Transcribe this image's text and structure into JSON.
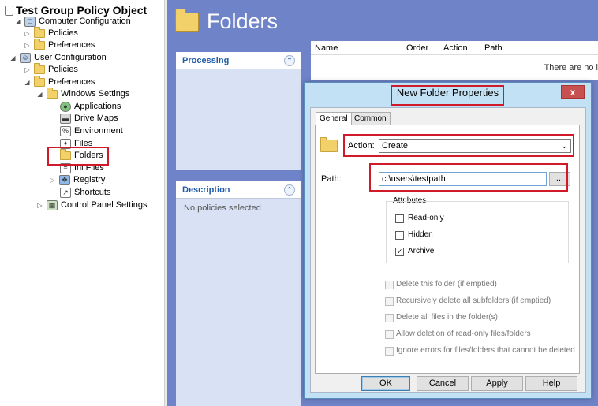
{
  "tree": {
    "root": "Test Group Policy Object",
    "items": [
      {
        "label": "Computer Configuration"
      },
      {
        "label": "Policies"
      },
      {
        "label": "Preferences"
      },
      {
        "label": "User Configuration"
      },
      {
        "label": "Policies"
      },
      {
        "label": "Preferences"
      },
      {
        "label": "Windows Settings"
      },
      {
        "label": "Applications"
      },
      {
        "label": "Drive Maps"
      },
      {
        "label": "Environment"
      },
      {
        "label": "Files"
      },
      {
        "label": "Folders"
      },
      {
        "label": "Ini Files"
      },
      {
        "label": "Registry"
      },
      {
        "label": "Shortcuts"
      },
      {
        "label": "Control Panel Settings"
      }
    ]
  },
  "header": {
    "title": "Folders"
  },
  "panels": {
    "processing": {
      "title": "Processing"
    },
    "description": {
      "title": "Description",
      "text": "No policies selected"
    }
  },
  "list": {
    "columns": [
      "Name",
      "Order",
      "Action",
      "Path"
    ],
    "empty_text": "There are no i"
  },
  "dialog": {
    "title": "New Folder Properties",
    "close": "x",
    "tabs": [
      "General",
      "Common"
    ],
    "action_label": "Action:",
    "action_value": "Create",
    "path_label": "Path:",
    "path_value": "c:\\users\\testpath",
    "browse_label": "...",
    "attributes_label": "Attributes",
    "attributes": [
      {
        "label": "Read-only",
        "checked": false
      },
      {
        "label": "Hidden",
        "checked": false
      },
      {
        "label": "Archive",
        "checked": true
      }
    ],
    "options": [
      {
        "label": "Delete this folder (if emptied)"
      },
      {
        "label": "Recursively delete all subfolders (if emptied)"
      },
      {
        "label": "Delete all files in the folder(s)"
      },
      {
        "label": "Allow deletion of read-only files/folders"
      },
      {
        "label": "Ignore errors for files/folders that cannot be deleted"
      }
    ],
    "buttons": {
      "ok": "OK",
      "cancel": "Cancel",
      "apply": "Apply",
      "help": "Help"
    }
  },
  "colors": {
    "highlight_box": "#d01a2a",
    "workspace_blue": "#6f83c8",
    "dialog_frame": "#c3e1f4"
  }
}
